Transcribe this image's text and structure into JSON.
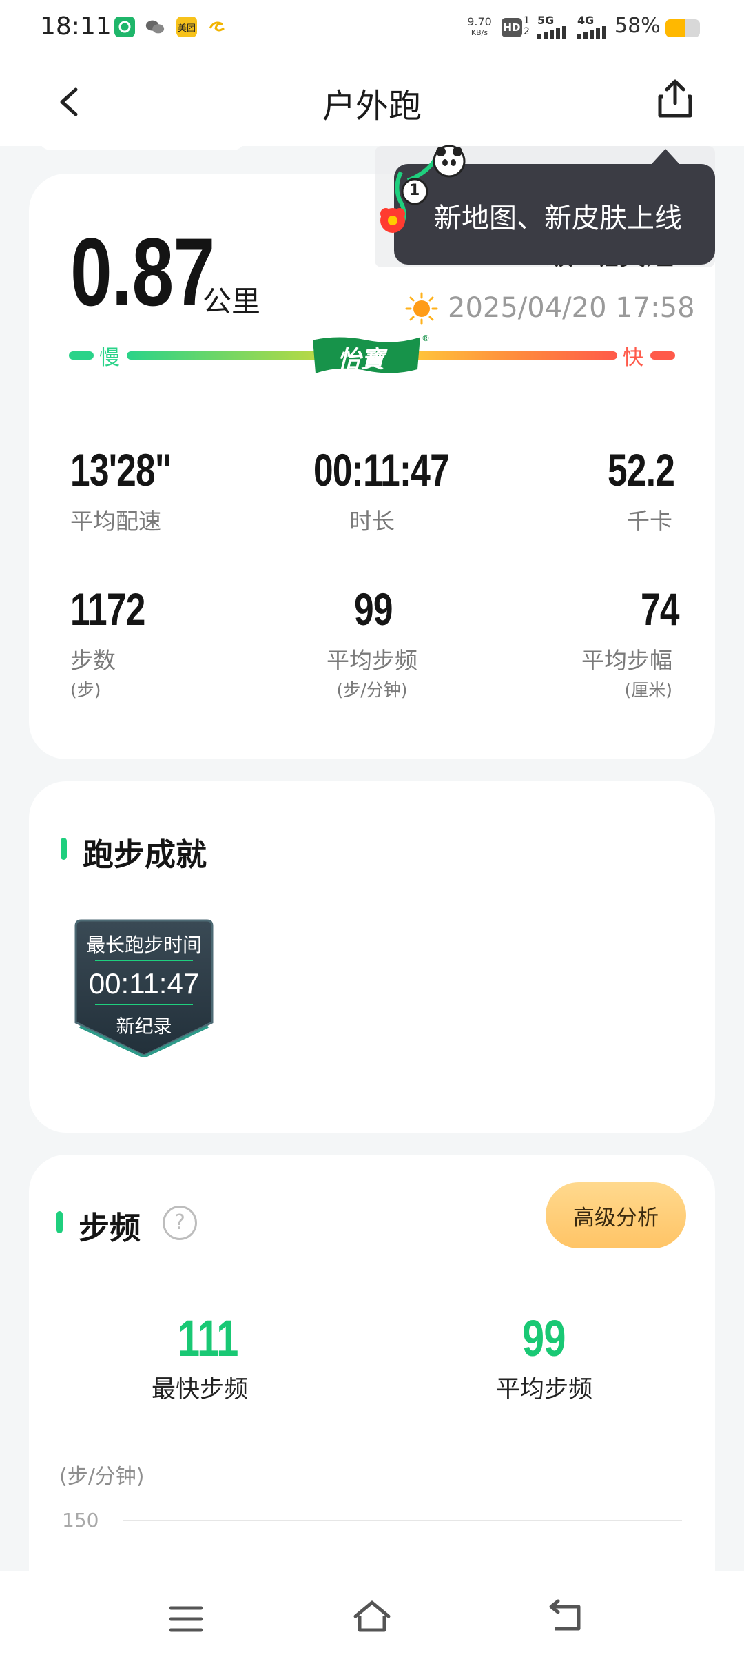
{
  "status_bar": {
    "time": "18:11",
    "net_speed_value": "9.70",
    "net_speed_unit": "KB/s",
    "hd": "HD",
    "sim1": "1",
    "sim2": "2",
    "sig1": "5G",
    "sig2": "4G",
    "battery": "58%",
    "app_icon_meituan": "美团"
  },
  "nav": {
    "title": "户外跑"
  },
  "tooltip": {
    "text": "新地图、新皮肤上线",
    "marker_number": "1"
  },
  "summary": {
    "distance": "0.87",
    "distance_unit": "公里",
    "user_partial": "24级4班黄短",
    "datetime": "2025/04/20 17:58",
    "pace_slow": "慢",
    "pace_fast": "快",
    "brand": "怡寶",
    "stats_row1": [
      {
        "value": "13'28\"",
        "label": "平均配速"
      },
      {
        "value": "00:11:47",
        "label": "时长"
      },
      {
        "value": "52.2",
        "label": "千卡"
      }
    ],
    "stats_row2": [
      {
        "value": "1172",
        "label": "步数",
        "unit": "(步)"
      },
      {
        "value": "99",
        "label": "平均步频",
        "unit": "(步/分钟)"
      },
      {
        "value": "74",
        "label": "平均步幅",
        "unit": "(厘米)"
      }
    ]
  },
  "achievement": {
    "title": "跑步成就",
    "badge": {
      "title": "最长跑步时间",
      "value": "00:11:47",
      "tag": "新纪录"
    }
  },
  "cadence": {
    "title": "步频",
    "help": "?",
    "advanced_button": "高级分析",
    "fastest_value": "111",
    "fastest_label": "最快步频",
    "avg_value": "99",
    "avg_label": "平均步频",
    "chart_unit": "(步/分钟)",
    "chart_tick": "150"
  },
  "colors": {
    "accent": "#1fcf7e",
    "pace_slow": "#2ad389",
    "pace_fast": "#ff5a4a",
    "tooltip_bg": "#3b3c44",
    "button_bg": "#ffc466"
  }
}
